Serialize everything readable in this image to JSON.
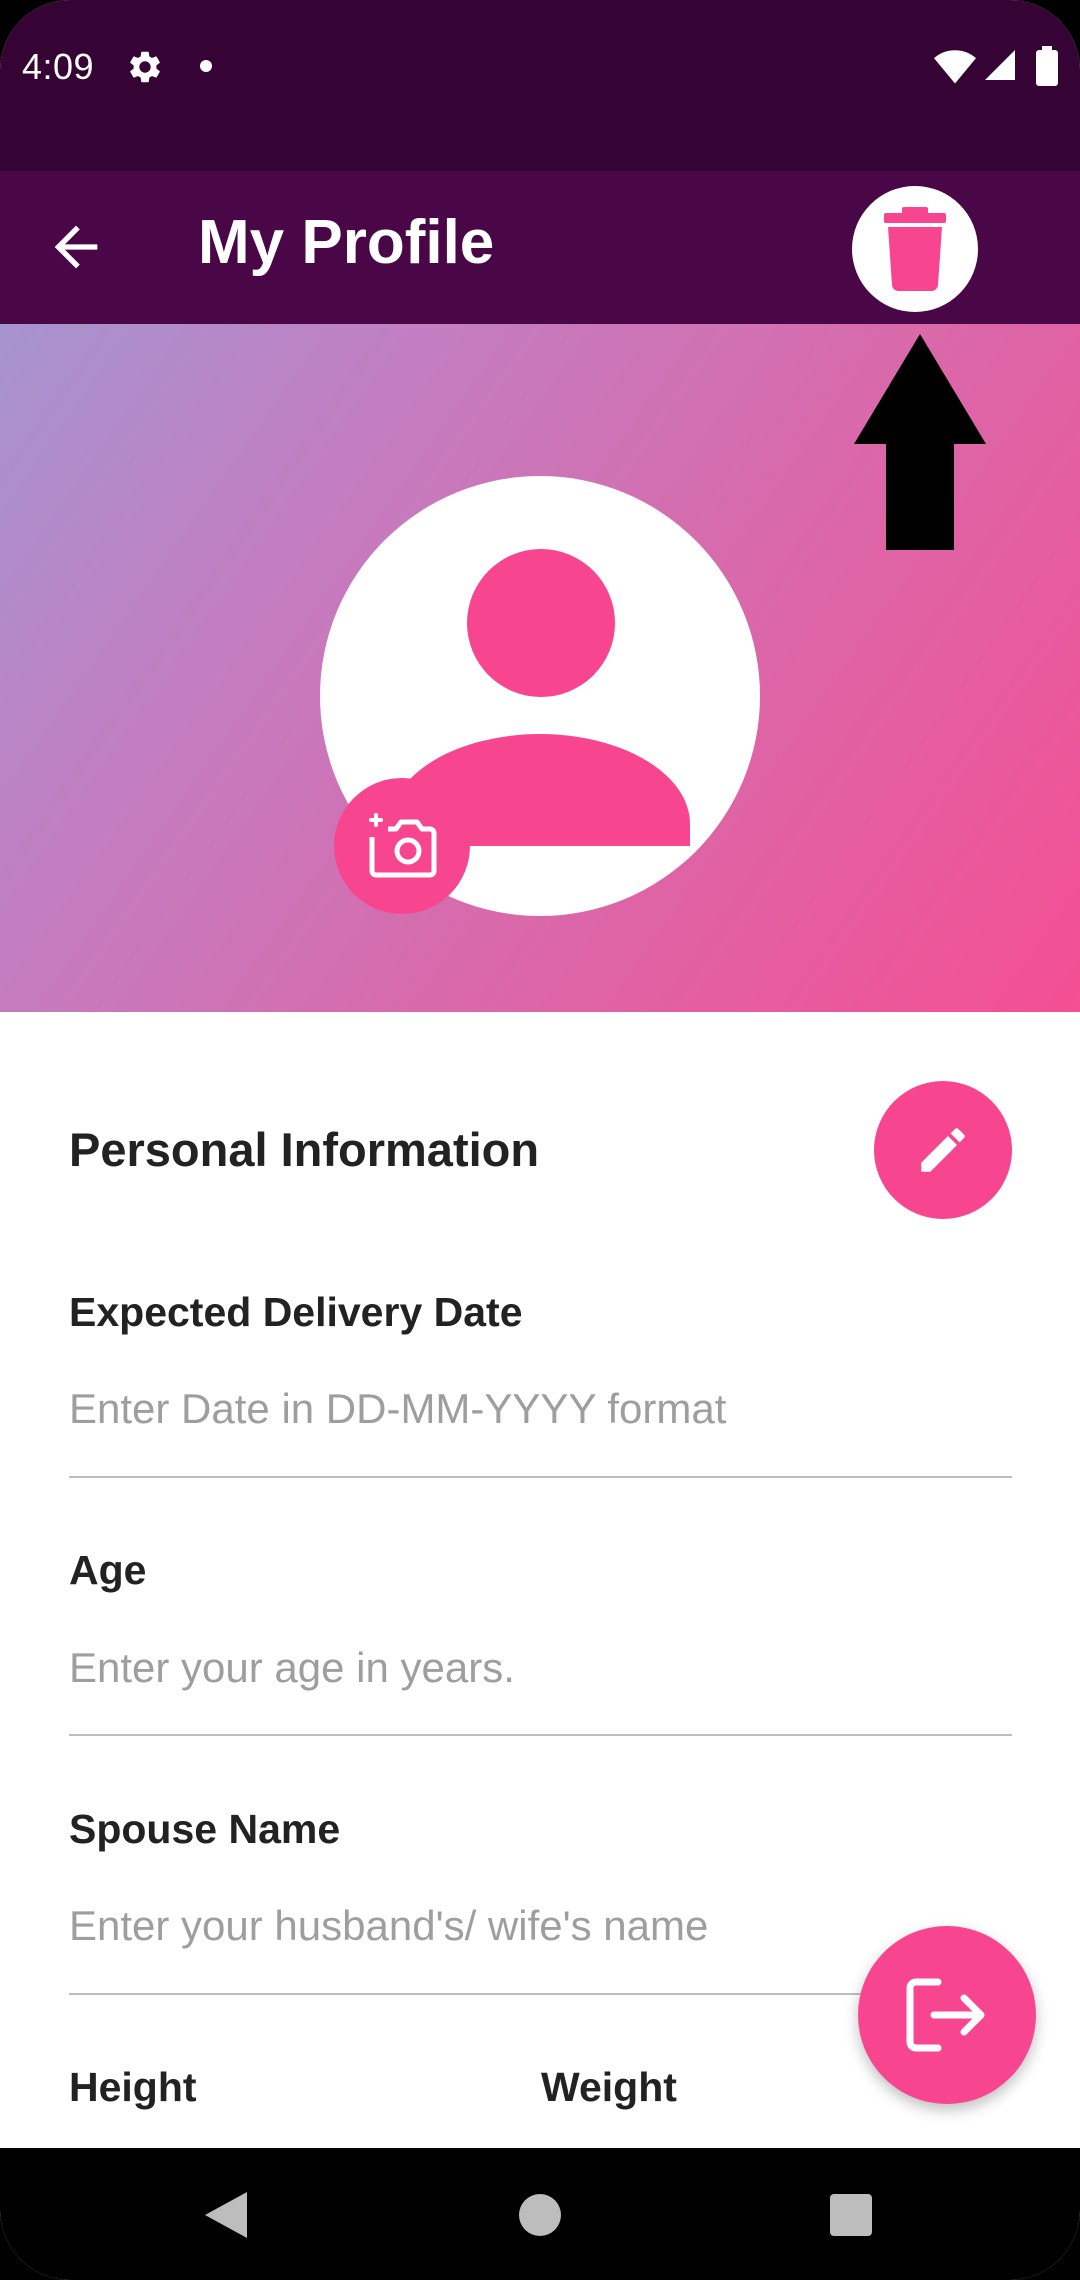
{
  "status_bar": {
    "time": "4:09"
  },
  "app_bar": {
    "title": "My Profile"
  },
  "icons": {
    "back": "arrow-left-icon",
    "delete": "trash-icon",
    "camera": "add-camera-icon",
    "edit": "pencil-icon",
    "logout": "logout-icon"
  },
  "colors": {
    "status_bar": "#360434",
    "app_bar": "#4a0747",
    "accent": "#f7468f"
  },
  "profile": {
    "section_title": "Personal Information",
    "fields": [
      {
        "label": "Expected Delivery Date",
        "value": "",
        "placeholder": "Enter Date in DD-MM-YYYY format"
      },
      {
        "label": "Age",
        "value": "",
        "placeholder": "Enter your age in years."
      },
      {
        "label": "Spouse Name",
        "value": "",
        "placeholder": "Enter your husband's/ wife's name"
      }
    ],
    "height_label": "Height",
    "weight_label": "Weight"
  }
}
